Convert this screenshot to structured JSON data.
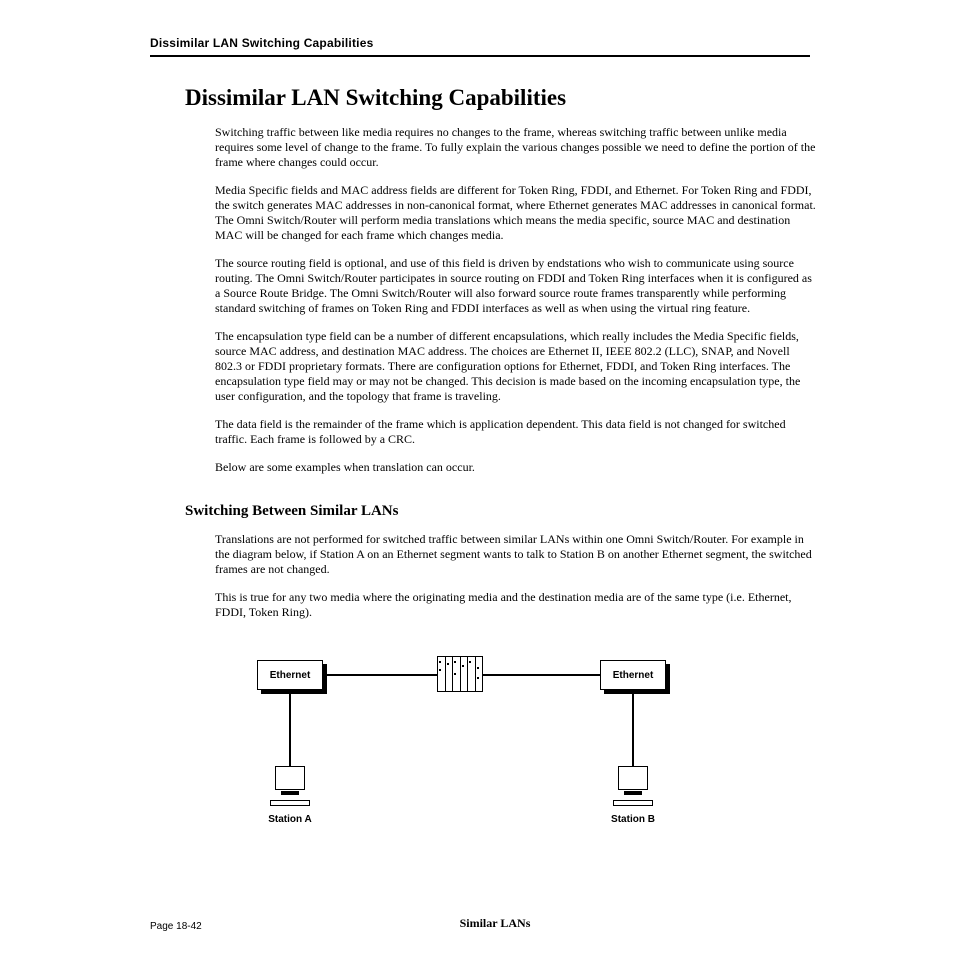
{
  "header": {
    "running_head": "Dissimilar LAN Switching Capabilities"
  },
  "title": "Dissimilar LAN Switching Capabilities",
  "paragraphs": {
    "p1": "Switching traffic between like media requires no changes to the frame, whereas switching traffic between unlike media requires some level of change to the frame. To fully explain the various changes possible we need to define the portion of the frame where changes could occur.",
    "p2": "Media Specific fields and MAC address fields are different for Token Ring, FDDI, and Ethernet. For Token Ring and FDDI, the switch generates MAC addresses in non-canonical format, where Ethernet generates MAC addresses in canonical format. The Omni Switch/Router will perform media translations which means the media specific, source MAC and destination MAC will be changed for each frame which changes media.",
    "p3": "The source routing field is optional, and use of this field is driven by endstations who wish to communicate using source routing. The Omni Switch/Router participates in source routing on FDDI and Token Ring interfaces when it is configured as a Source Route Bridge. The Omni Switch/Router will also forward source route frames transparently while performing standard switching of frames on Token Ring and FDDI interfaces as well as when using the virtual ring feature.",
    "p4": "The encapsulation type field can be a number of different encapsulations, which really includes the Media Specific fields, source MAC address, and destination MAC address. The choices are Ethernet II, IEEE 802.2 (LLC), SNAP, and Novell 802.3 or FDDI proprietary formats. There are configuration options for Ethernet, FDDI, and Token Ring interfaces. The encapsulation type field may or may not be changed. This decision is made based on the incoming encapsulation type, the user configuration, and the topology that frame is traveling.",
    "p5": "The data field is the remainder of the frame which is application dependent. This data field is not changed for switched traffic. Each frame is followed by a CRC.",
    "p6": "Below are some examples when translation can occur."
  },
  "subtitle": "Switching Between Similar LANs",
  "sub_paragraphs": {
    "sp1": "Translations are not performed for switched traffic between similar LANs within one Omni Switch/Router. For example in the diagram below, if Station A on an Ethernet segment wants to talk to Station B on another Ethernet segment, the switched frames are not changed.",
    "sp2": "This is true for any two media where the originating media and the destination media are of the same type (i.e. Ethernet, FDDI, Token Ring)."
  },
  "diagram": {
    "left_net": "Ethernet",
    "right_net": "Ethernet",
    "station_a": "Station A",
    "station_b": "Station B",
    "caption": "Similar LANs"
  },
  "footer": {
    "page_number": "Page 18-42"
  }
}
